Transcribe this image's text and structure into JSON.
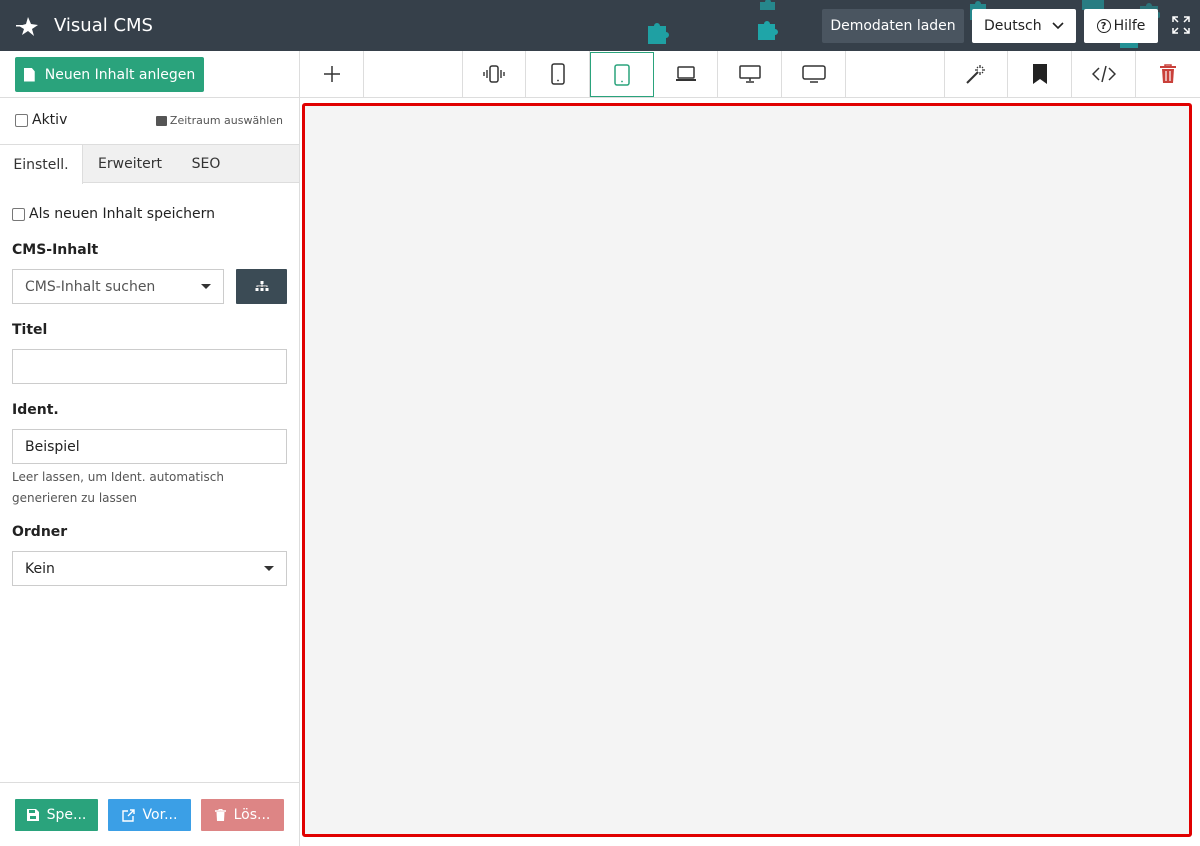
{
  "header": {
    "app_title": "Visual CMS",
    "demo_button": "Demodaten laden",
    "language": "Deutsch",
    "help_button": "Hilfe",
    "puzzle_color": "#1fa5a8"
  },
  "toolbar": {
    "new_content_button": "Neuen Inhalt anlegen",
    "active_device": "tablet",
    "icons": [
      "plus-icon",
      "vibrate-icon",
      "mobile-icon",
      "tablet-icon",
      "laptop-icon",
      "desktop-icon",
      "tv-icon",
      "magic-wand-icon",
      "bookmark-icon",
      "code-icon",
      "trash-icon"
    ]
  },
  "sidebar": {
    "active_label": "Aktiv",
    "period_label": "Zeitraum auswählen",
    "tabs": [
      {
        "label": "Einstell."
      },
      {
        "label": "Erweitert"
      },
      {
        "label": "SEO"
      }
    ],
    "save_as_new_label": "Als neuen Inhalt speichern",
    "cms_content_label": "CMS-Inhalt",
    "cms_content_placeholder": "CMS-Inhalt suchen",
    "title_label": "Titel",
    "title_value": "",
    "ident_label": "Ident.",
    "ident_value": "Beispiel",
    "ident_help": "Leer lassen, um Ident. automatisch generieren zu lassen",
    "folder_label": "Ordner",
    "folder_value": "Kein",
    "footer": {
      "save": "Spe...",
      "preview": "Vor...",
      "delete": "Lös..."
    }
  },
  "colors": {
    "header_bg": "#36404a",
    "accent_green": "#2aa37c",
    "preview_blue": "#3b9fe6",
    "delete_red": "#dd8585",
    "frame_red": "#e00000"
  }
}
